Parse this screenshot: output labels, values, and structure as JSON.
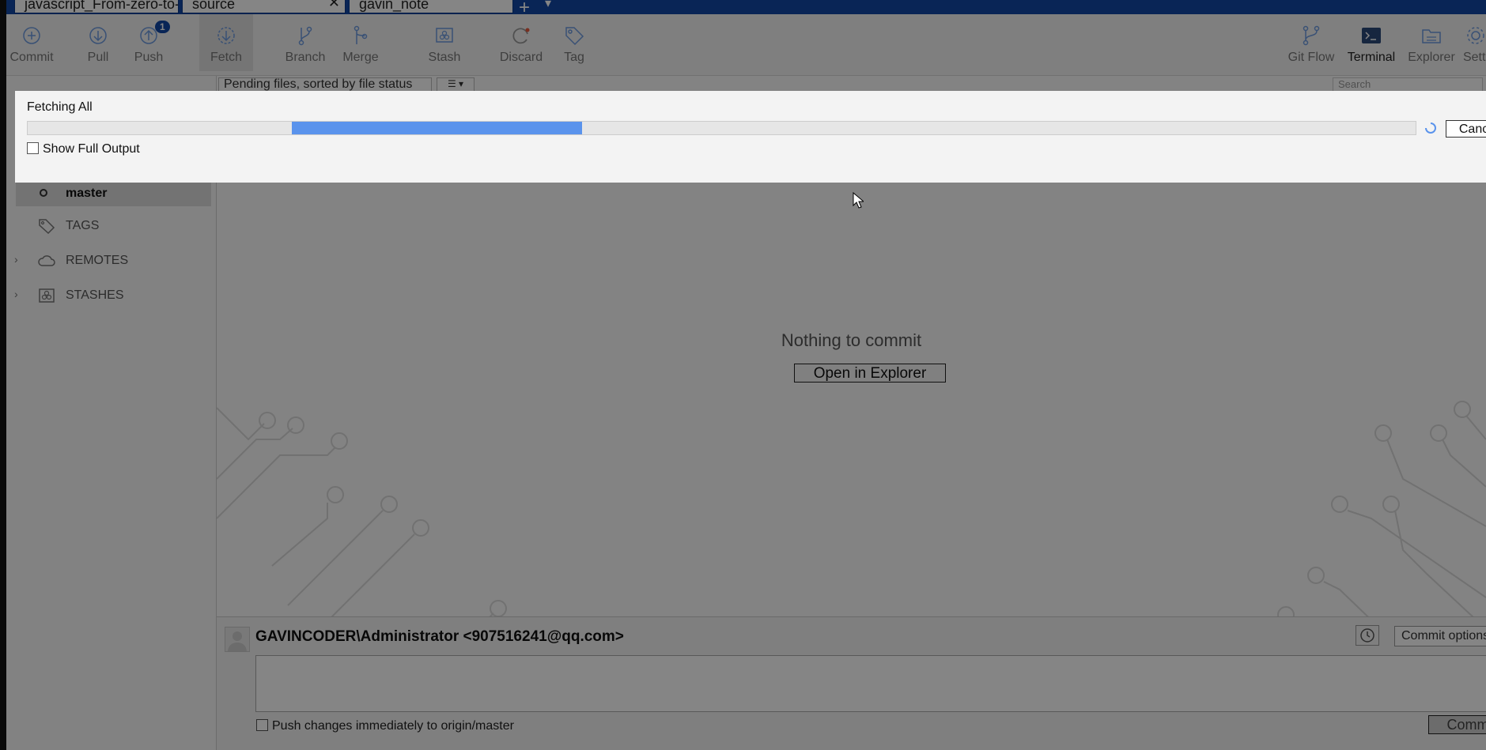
{
  "tabs": [
    {
      "label": "javascript_From-zero-to-..."
    },
    {
      "label": "source",
      "close": "✕"
    },
    {
      "label": "gavin_note"
    }
  ],
  "tabbar": {
    "add": "+",
    "more": "▾"
  },
  "toolbar": {
    "commit": "Commit",
    "pull": "Pull",
    "push": "Push",
    "push_badge": "1",
    "fetch": "Fetch",
    "branch": "Branch",
    "merge": "Merge",
    "stash": "Stash",
    "discard": "Discard",
    "tag": "Tag",
    "git_flow": "Git Flow",
    "terminal": "Terminal",
    "explorer": "Explorer",
    "settings": "Setti"
  },
  "sidebar": {
    "branch_master": "master",
    "tags": "TAGS",
    "remotes": "REMOTES",
    "stashes": "STASHES",
    "chevron": "›"
  },
  "filter": {
    "sort_label": "Pending files, sorted by file status",
    "search_placeholder": "Search"
  },
  "main": {
    "nothing_to_commit": "Nothing to commit",
    "open_in_explorer": "Open in Explorer"
  },
  "commit": {
    "author": "GAVINCODER\\Administrator <907516241@qq.com>",
    "options": "Commit options",
    "push_immediately": "Push changes immediately to origin/master",
    "commit_button": "Comm"
  },
  "dialog": {
    "title": "Fetching All",
    "cancel": "Cance",
    "show_full_output": "Show Full Output",
    "progress_indeterminate": true
  },
  "colors": {
    "tabbar": "#1348a5",
    "accent": "#5a93ec",
    "icon_blue": "#6e9be0",
    "discard_red": "#e8583c"
  }
}
